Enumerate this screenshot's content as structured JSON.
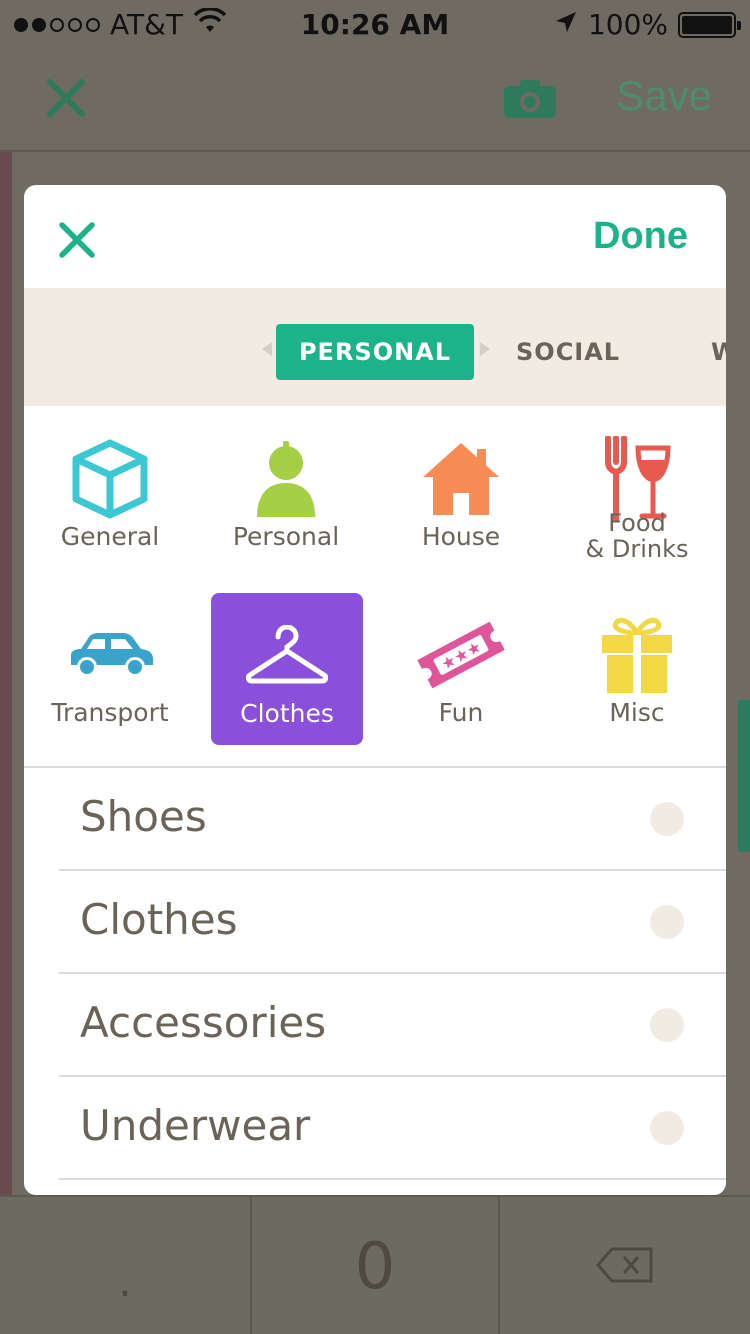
{
  "status_bar": {
    "carrier": "AT&T",
    "time": "10:26 AM",
    "battery": "100%",
    "signal_bars_filled": 2,
    "signal_bars_total": 5
  },
  "background": {
    "save_label": "Save",
    "keypad": {
      "decimal": ".",
      "zero": "0"
    }
  },
  "modal": {
    "done_label": "Done",
    "tabs": [
      {
        "label": "PERSONAL",
        "active": true
      },
      {
        "label": "SOCIAL",
        "active": false
      },
      {
        "label": "W",
        "active": false
      }
    ],
    "categories": [
      {
        "label": "General",
        "icon": "box-icon",
        "color": "#3cc8d2"
      },
      {
        "label": "Personal",
        "icon": "person-icon",
        "color": "#a5cf45"
      },
      {
        "label": "House",
        "icon": "house-icon",
        "color": "#f78d55"
      },
      {
        "label": "Food",
        "label2": "& Drinks",
        "icon": "fork-wine-icon",
        "color": "#e85a4f"
      },
      {
        "label": "Transport",
        "icon": "car-icon",
        "color": "#3aa3c9"
      },
      {
        "label": "Clothes",
        "icon": "hanger-icon",
        "color": "#8a4fdb",
        "selected": true
      },
      {
        "label": "Fun",
        "icon": "ticket-icon",
        "color": "#e0559a"
      },
      {
        "label": "Misc",
        "icon": "gift-icon",
        "color": "#f2d845"
      }
    ],
    "subcategories": [
      "Shoes",
      "Clothes",
      "Accessories",
      "Underwear"
    ]
  },
  "colors": {
    "accent": "#1db38a",
    "selected_category": "#8a4fdb",
    "text": "#6b6357",
    "tab_bar_bg": "#f1ebe4"
  }
}
